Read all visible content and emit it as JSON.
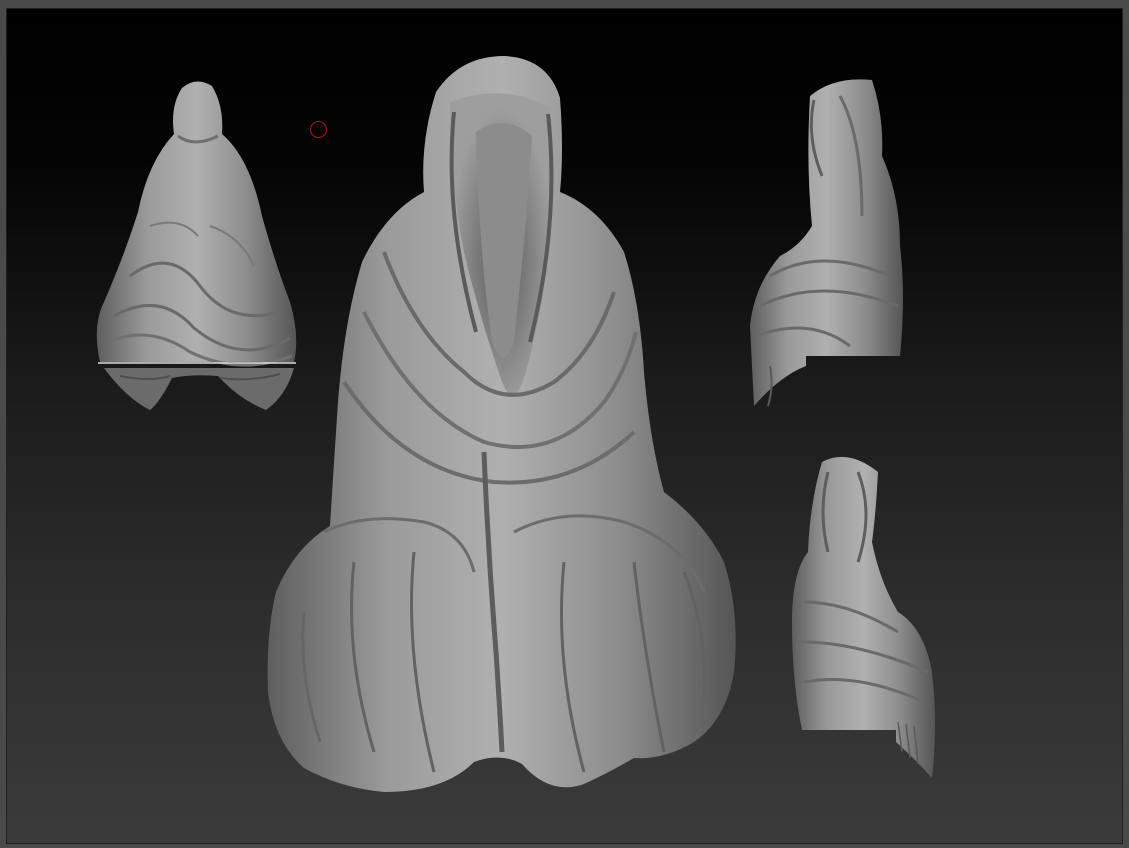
{
  "canvas": {
    "background_top": "#000000",
    "background_bottom": "#3b3b3b",
    "frame_color": "#4a4a4a"
  },
  "model": {
    "name": "hooded-robed-figure",
    "views": [
      "back",
      "front",
      "side-right",
      "three-quarter-right"
    ],
    "material_color": "#8e8e8e"
  },
  "brush_cursor": {
    "icon": "circle-icon",
    "color": "#b01818"
  }
}
